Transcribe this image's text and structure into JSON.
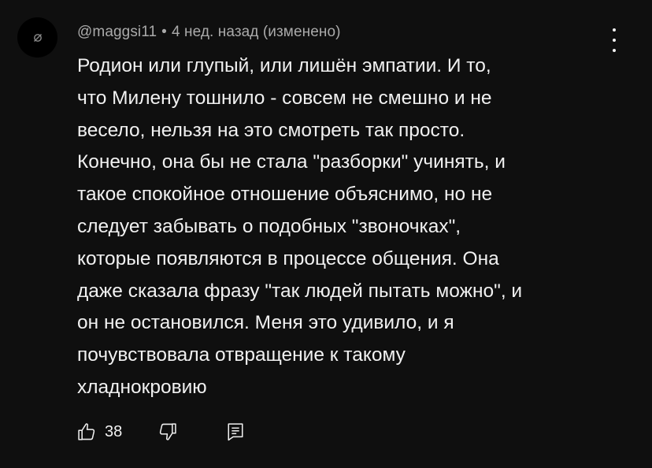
{
  "comment": {
    "author": "@maggsi11",
    "separator": "•",
    "timestamp": "4 нед. назад (изменено)",
    "lines": [
      "Родион или глупый, или лишён эмпатии. И то,",
      "что Милену тошнило - совсем не смешно и не",
      "весело, нельзя на это смотреть так просто.",
      "Конечно, она бы не стала \"разборки\" учинять, и",
      "такое спокойное отношение объяснимо, но не",
      "следует забывать о подобных \"звоночках\",",
      "которые появляются в процессе общения. Она",
      "даже сказала фразу \"так людей пытать можно\", и",
      "он не остановился. Меня это удивило, и я",
      "почувствовала отвращение к такому",
      "хладнокровию"
    ]
  },
  "actions": {
    "like_count": "38",
    "like_icon": "thumbs-up-icon",
    "dislike_icon": "thumbs-down-icon",
    "reply_icon": "reply-icon"
  },
  "menu_icon": "more-vertical-icon",
  "colors": {
    "background": "#0f0f0f",
    "text": "#f1f1f1",
    "meta_text": "#aaaaaa"
  }
}
